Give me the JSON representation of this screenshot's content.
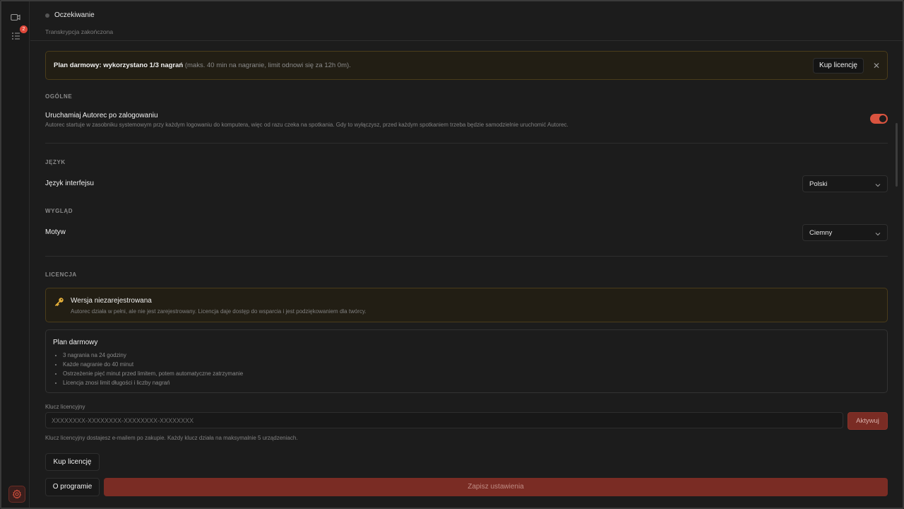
{
  "sidebar": {
    "badge_count": "2",
    "icons": [
      "video-camera-icon",
      "task-list-icon",
      "settings-gear-icon"
    ]
  },
  "status": {
    "title": "Oczekiwanie",
    "subtitle": "Transkrypcja zakończona"
  },
  "banner": {
    "bold_text": "Plan darmowy: wykorzystano 1/3 nagrań",
    "muted_text": "(maks. 40 min na nagranie, limit odnowi się za 12h 0m).",
    "buy_label": "Kup licencję",
    "close_glyph": "✕"
  },
  "general": {
    "section_label": "OGÓLNE",
    "autostart_title": "Uruchamiaj Autorec po zalogowaniu",
    "autostart_desc": "Autorec startuje w zasobniku systemowym przy każdym logowaniu do komputera, więc od razu czeka na spotkania. Gdy to wyłączysz, przed każdym spotkaniem trzeba będzie samodzielnie uruchomić Autorec.",
    "autostart_enabled": true
  },
  "language": {
    "section_label": "JĘZYK",
    "row_title": "Język interfejsu",
    "selected": "Polski"
  },
  "appearance": {
    "section_label": "WYGLĄD",
    "row_title": "Motyw",
    "selected": "Ciemny"
  },
  "license": {
    "section_label": "LICENCJA",
    "status_title": "Wersja niezarejestrowana",
    "status_desc": "Autorec działa w pełni, ale nie jest zarejestrowany. Licencja daje dostęp do wsparcia i jest podziękowaniem dla twórcy.",
    "plan_title": "Plan darmowy",
    "plan_items": [
      "3 nagrania na 24 godziny",
      "Każde nagranie do 40 minut",
      "Ostrzeżenie pięć minut przed limitem, potem automatyczne zatrzymanie",
      "Licencja znosi limit długości i liczby nagrań"
    ],
    "key_label": "Klucz licencyjny",
    "key_placeholder": "XXXXXXXX-XXXXXXXX-XXXXXXXX-XXXXXXXX",
    "activate_label": "Aktywuj",
    "key_hint": "Klucz licencyjny dostajesz e-mailem po zakupie. Każdy klucz działa na maksymalnie 5 urządzeniach.",
    "buy_label": "Kup licencję"
  },
  "footer": {
    "about_label": "O programie",
    "save_label": "Zapisz ustawienia"
  },
  "colors": {
    "accent": "#d9533f",
    "save_button": "#7a2c24",
    "warning_border": "#4a3c1a",
    "warning_bg": "#221e14",
    "key_icon": "#e8b23a"
  }
}
